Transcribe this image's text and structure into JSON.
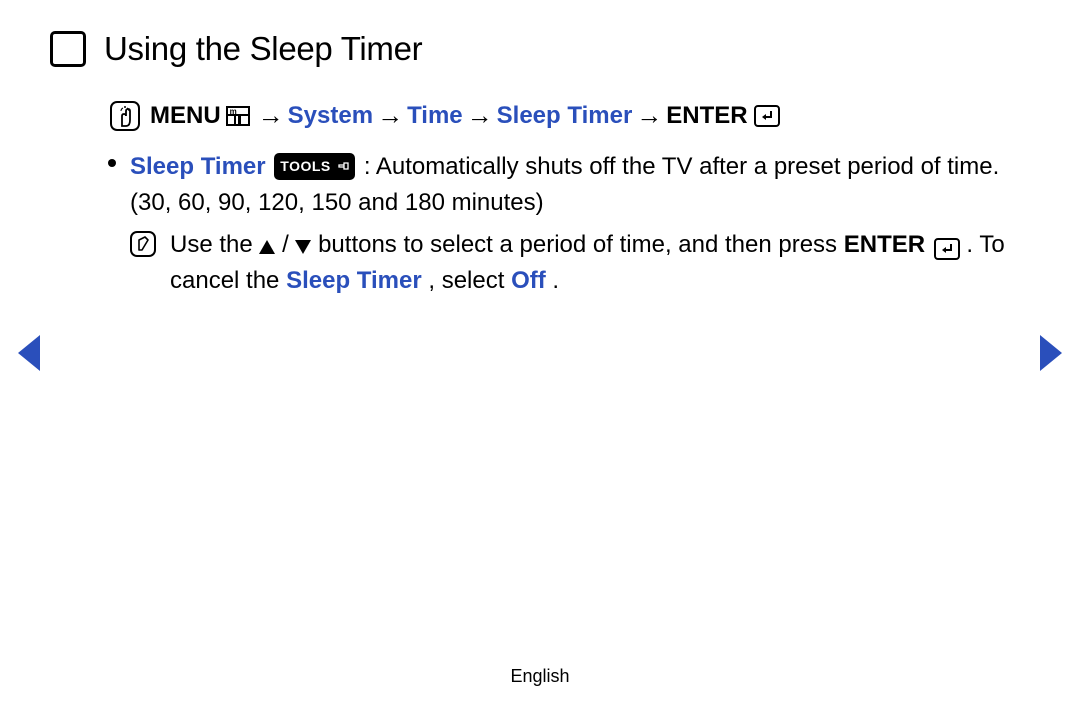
{
  "header": {
    "title": "Using the Sleep Timer"
  },
  "path": {
    "menu": "MENU",
    "system": "System",
    "time": "Time",
    "sleep_timer": "Sleep Timer",
    "enter": "ENTER",
    "sep": "→"
  },
  "body": {
    "sleep_timer_label": "Sleep Timer",
    "tools": "TOOLS",
    "desc": ": Automatically shuts off the TV after a preset period of time. (30, 60, 90, 120, 150 and 180 minutes)",
    "note_pre": "Use the ",
    "note_mid": " buttons to select a period of time, and then press ",
    "enter2": "ENTER",
    "note_post": ". To cancel the ",
    "sleep_timer2": "Sleep Timer",
    "note_post2": ", select ",
    "off": "Off",
    "period": ".",
    "slash": "/"
  },
  "footer": {
    "lang": "English"
  }
}
